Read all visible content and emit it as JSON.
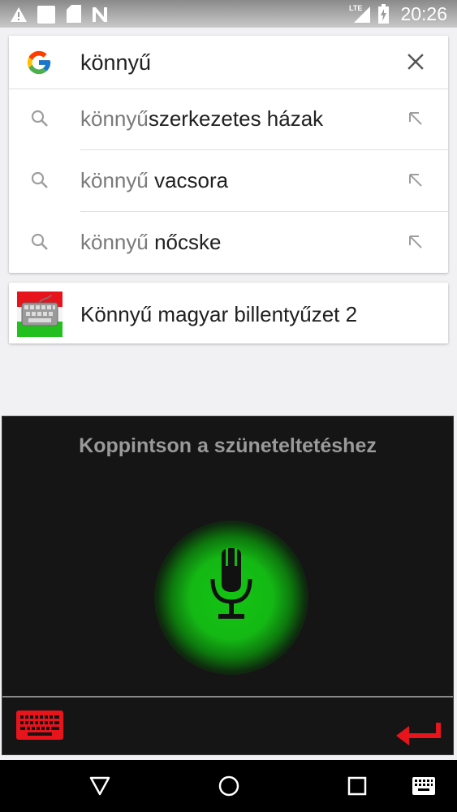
{
  "status_bar": {
    "time": "20:26",
    "network_label": "LTE",
    "icons": [
      "warning-icon",
      "notification-square-icon",
      "sd-card-icon",
      "n-icon",
      "signal-icon",
      "battery-charging-icon"
    ]
  },
  "search": {
    "query": "könnyű",
    "clear_icon": "close-icon"
  },
  "suggestions": [
    {
      "prefix": "könnyű",
      "suffix": "szerkezetes házak"
    },
    {
      "prefix": "könnyű",
      "suffix": " vacsora"
    },
    {
      "prefix": "könnyű",
      "suffix": " nőcske"
    }
  ],
  "app_result": {
    "name": "Könnyű magyar billentyűzet 2",
    "icon": "keyboard-app-icon"
  },
  "voice": {
    "prompt": "Koppintson a szüneteltetéshez",
    "mic_color": "#14b814",
    "accent_red": "#e8141c"
  },
  "nav": {
    "buttons": [
      "back-icon",
      "home-icon",
      "recents-icon",
      "keyboard-icon"
    ]
  }
}
